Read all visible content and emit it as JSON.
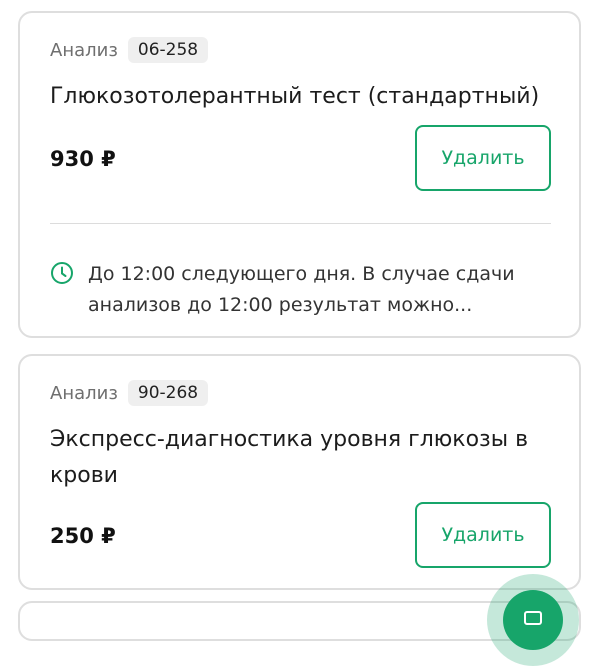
{
  "cards": [
    {
      "kind_label": "Анализ",
      "code": "06-258",
      "title": "Глюкозотолерантный тест (стандартный)",
      "price": "930 ₽",
      "delete_label": "Удалить",
      "info_text": "До 12:00 следующего дня. В случае сдачи анализов до 12:00 результат можно..."
    },
    {
      "kind_label": "Анализ",
      "code": "90-268",
      "title": "Экспресс-диагностика уровня глюкозы в крови",
      "price": "250 ₽",
      "delete_label": "Удалить"
    }
  ],
  "fab": {
    "icon": "chat-icon"
  },
  "colors": {
    "accent": "#17a56a",
    "border": "#dedede",
    "badge_bg": "#efefef"
  }
}
